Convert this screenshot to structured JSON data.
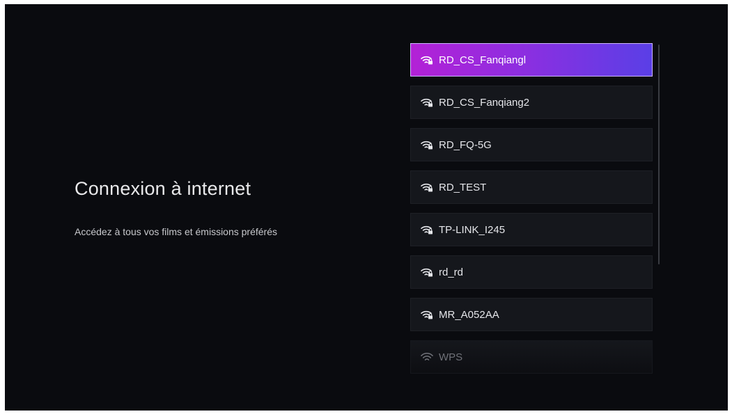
{
  "page": {
    "title": "Connexion à internet",
    "subtitle": "Accédez à tous vos films et émissions préférés"
  },
  "networks": [
    {
      "name": "RD_CS_Fanqiangl",
      "icon": "wifi-lock-icon",
      "selected": true
    },
    {
      "name": "RD_CS_Fanqiang2",
      "icon": "wifi-lock-icon",
      "selected": false
    },
    {
      "name": "RD_FQ-5G",
      "icon": "wifi-lock-icon",
      "selected": false
    },
    {
      "name": "RD_TEST",
      "icon": "wifi-lock-icon",
      "selected": false
    },
    {
      "name": "TP-LINK_I245",
      "icon": "wifi-lock-icon",
      "selected": false
    },
    {
      "name": "rd_rd",
      "icon": "wifi-lock-icon",
      "selected": false
    },
    {
      "name": "MR_A052AA",
      "icon": "wifi-lock-icon",
      "selected": false
    },
    {
      "name": "WPS",
      "icon": "wifi-icon",
      "selected": false
    }
  ],
  "colors": {
    "background": "#0a0b0f",
    "item_background": "#15171c",
    "selected_gradient_start": "#b321d6",
    "selected_gradient_end": "#5a3fe6"
  }
}
